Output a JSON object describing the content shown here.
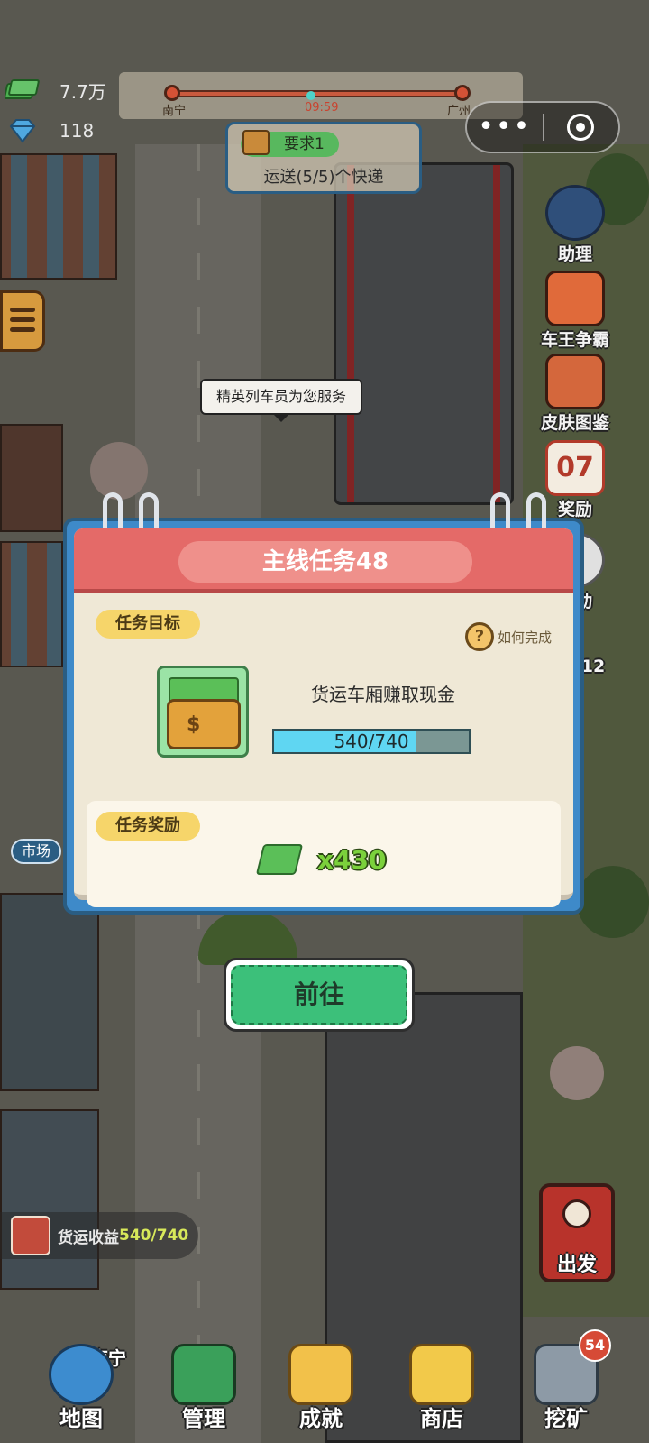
{
  "resources": {
    "cash": "7.7万",
    "gems": "118"
  },
  "route": {
    "from": "南宁",
    "time": "09:59",
    "to": "广州",
    "progress": 0.45
  },
  "capsule": {
    "menu_glyph": "•••"
  },
  "requirement": {
    "tag": "要求1",
    "text": "运送(5/5)个快递"
  },
  "side_buttons": [
    "助理",
    "车王争霸",
    "皮肤图鉴",
    "07",
    "奖励",
    "活动"
  ],
  "speech_bubble": "精英列车员为您服务",
  "market_label": "市场",
  "counter_12": "12",
  "cargo": {
    "label": "货运收益",
    "value": "540/740"
  },
  "depart_label": "出发",
  "location_label": "南宁",
  "bottom_nav": [
    "地图",
    "管理",
    "成就",
    "商店",
    "挖矿"
  ],
  "mining_badge": "54",
  "modal": {
    "title": "主线任务48",
    "goal_tag": "任务目标",
    "howto": "如何完成",
    "help_glyph": "?",
    "goal_text": "货运车厢赚取现金",
    "progress_text": "540/740",
    "progress_current": 540,
    "progress_total": 740,
    "reward_tag": "任务奖励",
    "reward_amount": "x430",
    "go_button": "前往"
  },
  "colors": {
    "modal_border": "#3e8ac9",
    "header": "#e46a68",
    "progress_fill": "#5fd6f2",
    "go_button": "#3cc07a",
    "tag": "#f6d56a"
  }
}
